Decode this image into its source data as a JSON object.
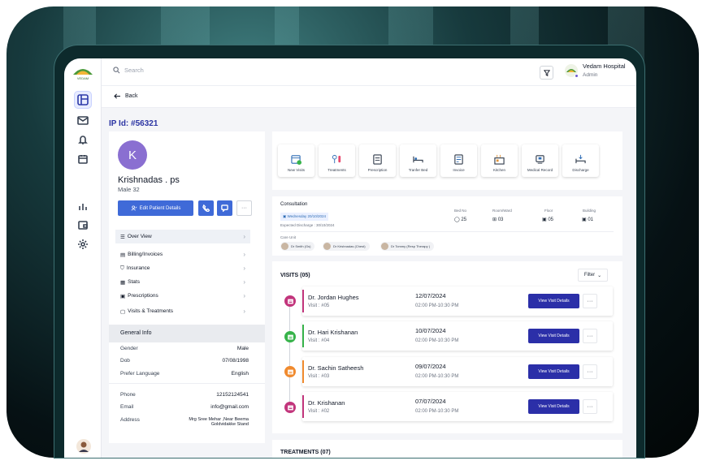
{
  "header": {
    "search_placeholder": "Search",
    "hospital_name": "Vedam Hospital",
    "role": "Admin",
    "logo_text": "VEDAM"
  },
  "back_label": "Back",
  "ip_id": "IP Id: #56321",
  "patient": {
    "initial": "K",
    "name": "Krishnadas . ps",
    "gender_age": "Male 32",
    "edit_label": "Edit Patient Details",
    "more_label": "···"
  },
  "menu": [
    {
      "label": "Over View",
      "icon": "list-icon"
    },
    {
      "label": "Billing/Invoices",
      "icon": "receipt-icon"
    },
    {
      "label": "Insurance",
      "icon": "shield-icon"
    },
    {
      "label": "Stats",
      "icon": "stats-icon"
    },
    {
      "label": "Prescriptions",
      "icon": "prescription-icon"
    },
    {
      "label": "Visits & Treatments",
      "icon": "calendar-icon"
    }
  ],
  "general_info": {
    "title": "General Info",
    "rows": [
      {
        "k": "Gender",
        "v": "Male"
      },
      {
        "k": "Dob",
        "v": "07/08/1998"
      },
      {
        "k": "Prefer Language",
        "v": "English"
      },
      {
        "k": "Phone",
        "v": "12152124541"
      },
      {
        "k": "Email",
        "v": "info@gmail.com"
      },
      {
        "k": "Address",
        "v": "Mrg Sree Mehar ,Near Beema Goldvidakke Stand"
      }
    ]
  },
  "actions": [
    {
      "label": "New Visits",
      "color": "#e84a6f"
    },
    {
      "label": "Treatments",
      "color": "#6d5bd0"
    },
    {
      "label": "Prescription",
      "color": "#2f6db5"
    },
    {
      "label": "Tranfer Bed",
      "color": "#2f6db5"
    },
    {
      "label": "Invoice",
      "color": "#2f6db5"
    },
    {
      "label": "Kitchen",
      "color": "#e0933a"
    },
    {
      "label": "Medical Record",
      "color": "#2f6db5"
    },
    {
      "label": "Discharge",
      "color": "#2f6db5"
    }
  ],
  "consultation": {
    "title": "Consultation",
    "date": "Wednesday 20/10/2024",
    "expected": "Expected Discharge : 30/10/2024",
    "bed_label": "Bed No",
    "bed": "25",
    "room_label": "Room/Ward",
    "room": "03",
    "floor_label": "Floor",
    "floor": "05",
    "building_label": "Building",
    "building": "01",
    "care_label": "Care Unit",
    "care": [
      "Dr Smith (Gs)",
      "Dr Krishnadas (Chest)",
      "Dr Tommy (Resp Therapy )"
    ]
  },
  "visits": {
    "title": "VISITS (05)",
    "filter": "Filter",
    "items": [
      {
        "doctor": "Dr. Jordan Hughes",
        "visit": "Visit : #05",
        "date": "12/07/2024",
        "time": "02:00 PM-10:30 PM",
        "color": "#c2357c",
        "btn": "View Visit Details"
      },
      {
        "doctor": "Dr. Hari Krishanan",
        "visit": "Visit : #04",
        "date": "10/07/2024",
        "time": "02:00 PM-10:30 PM",
        "color": "#37b34a",
        "btn": "View Visit Details"
      },
      {
        "doctor": "Dr. Sachin Satheesh",
        "visit": "Visit : #03",
        "date": "09/07/2024",
        "time": "02:00 PM-10:30 PM",
        "color": "#f08a2e",
        "btn": "View Visit Details"
      },
      {
        "doctor": "Dr.  Krishanan",
        "visit": "Visit : #02",
        "date": "07/07/2024",
        "time": "02:00 PM-10:30 PM",
        "color": "#c2357c",
        "btn": "View Visit Details"
      }
    ]
  },
  "treatments_title": "TREATMENTS (07)"
}
